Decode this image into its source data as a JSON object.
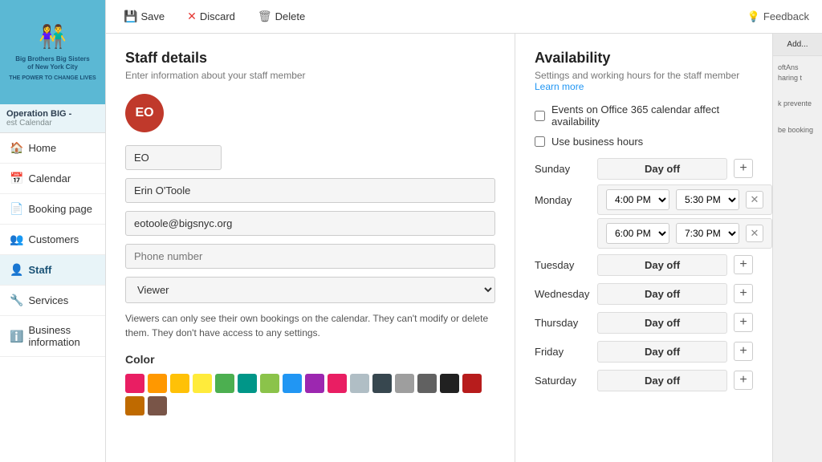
{
  "sidebar": {
    "logo": {
      "icon": "👫",
      "text": "Big Brothers Big Sisters\nof New York City",
      "tagline": "THE POWER TO CHANGE LIVES"
    },
    "org_title": "Operation BIG -",
    "org_subtitle": "est Calendar",
    "nav_items": [
      {
        "id": "home",
        "label": "Home",
        "icon": "🏠",
        "active": false
      },
      {
        "id": "calendar",
        "label": "Calendar",
        "icon": "📅",
        "active": false
      },
      {
        "id": "booking-page",
        "label": "Booking page",
        "icon": "📄",
        "active": false
      },
      {
        "id": "customers",
        "label": "Customers",
        "icon": "👥",
        "active": false
      },
      {
        "id": "staff",
        "label": "Staff",
        "icon": "👤",
        "active": true
      },
      {
        "id": "services",
        "label": "Services",
        "icon": "🔧",
        "active": false
      },
      {
        "id": "business-info",
        "label": "Business information",
        "icon": "ℹ️",
        "active": false
      }
    ]
  },
  "toolbar": {
    "save_label": "Save",
    "discard_label": "Discard",
    "delete_label": "Delete",
    "feedback_label": "Feedback"
  },
  "staff_details": {
    "title": "Staff details",
    "subtitle": "Enter information about your staff member",
    "avatar_initials": "EO",
    "short_name": "EO",
    "full_name": "Erin O'Toole",
    "email": "eotoole@bigsnyc.org",
    "phone_placeholder": "Phone number",
    "role": "Viewer",
    "role_note": "Viewers can only see their own bookings on the calendar. They can't modify or delete them. They don't have access to any settings.",
    "color_section": "Color",
    "colors": [
      "#e91e63",
      "#ff9800",
      "#ffc107",
      "#ffeb3b",
      "#4caf50",
      "#009688",
      "#8bc34a",
      "#2196f3",
      "#9c27b0",
      "#e91e63",
      "#b0bec5",
      "#37474f",
      "#9e9e9e",
      "#616161",
      "#212121",
      "#b71c1c",
      "#bf6a00",
      "#795548"
    ]
  },
  "availability": {
    "title": "Availability",
    "subtitle": "Settings and working hours for the staff member",
    "learn_more": "Learn more",
    "office365_label": "Events on Office 365 calendar affect availability",
    "business_hours_label": "Use business hours",
    "days": [
      {
        "id": "sunday",
        "label": "Sunday",
        "type": "day_off",
        "day_off_text": "Day off",
        "slots": []
      },
      {
        "id": "monday",
        "label": "Monday",
        "type": "slots",
        "slots": [
          {
            "start": "4:00 PM",
            "end": "5:30 PM"
          },
          {
            "start": "6:00 PM",
            "end": "7:30 PM"
          }
        ]
      },
      {
        "id": "tuesday",
        "label": "Tuesday",
        "type": "day_off",
        "day_off_text": "Day off",
        "slots": []
      },
      {
        "id": "wednesday",
        "label": "Wednesday",
        "type": "day_off",
        "day_off_text": "Day off",
        "slots": []
      },
      {
        "id": "thursday",
        "label": "Thursday",
        "type": "day_off",
        "day_off_text": "Day off",
        "slots": []
      },
      {
        "id": "friday",
        "label": "Friday",
        "type": "day_off",
        "day_off_text": "Day off",
        "slots": []
      },
      {
        "id": "saturday",
        "label": "Saturday",
        "type": "day_off",
        "day_off_text": "Day off",
        "slots": []
      }
    ]
  },
  "right_panel": {
    "add_label": "Add...",
    "preview_text": "oftAns\nharing t\nk prevente\nbe booking"
  }
}
